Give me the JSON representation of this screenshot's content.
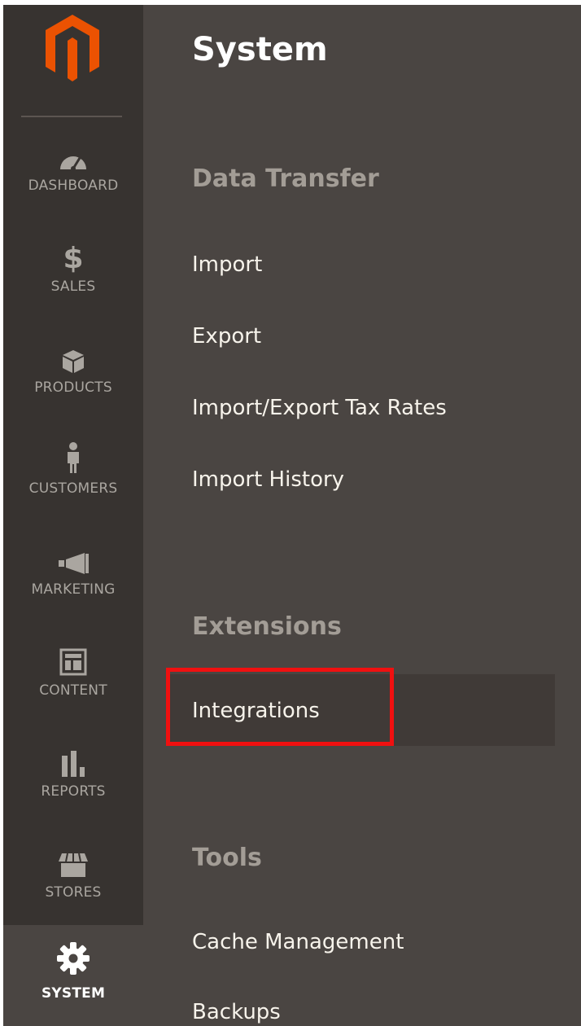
{
  "sidebar": {
    "items": [
      {
        "id": "dashboard",
        "label": "DASHBOARD",
        "icon": "gauge-icon"
      },
      {
        "id": "sales",
        "label": "SALES",
        "icon": "dollar-icon"
      },
      {
        "id": "products",
        "label": "PRODUCTS",
        "icon": "box-icon"
      },
      {
        "id": "customers",
        "label": "CUSTOMERS",
        "icon": "person-icon"
      },
      {
        "id": "marketing",
        "label": "MARKETING",
        "icon": "megaphone-icon"
      },
      {
        "id": "content",
        "label": "CONTENT",
        "icon": "layout-icon"
      },
      {
        "id": "reports",
        "label": "REPORTS",
        "icon": "bar-chart-icon"
      },
      {
        "id": "stores",
        "label": "STORES",
        "icon": "storefront-icon"
      },
      {
        "id": "system",
        "label": "SYSTEM",
        "icon": "gear-icon",
        "active": true
      }
    ]
  },
  "panel": {
    "title": "System",
    "sections": [
      {
        "title": "Data Transfer",
        "links": [
          "Import",
          "Export",
          "Import/Export Tax Rates",
          "Import History"
        ]
      },
      {
        "title": "Extensions",
        "links": [
          "Integrations"
        ]
      },
      {
        "title": "Tools",
        "links": [
          "Cache Management",
          "Backups"
        ]
      }
    ]
  },
  "colors": {
    "rail_bg": "#373330",
    "panel_bg": "#4a4542",
    "brand_orange": "#eb5202",
    "highlight": "#f01010"
  }
}
